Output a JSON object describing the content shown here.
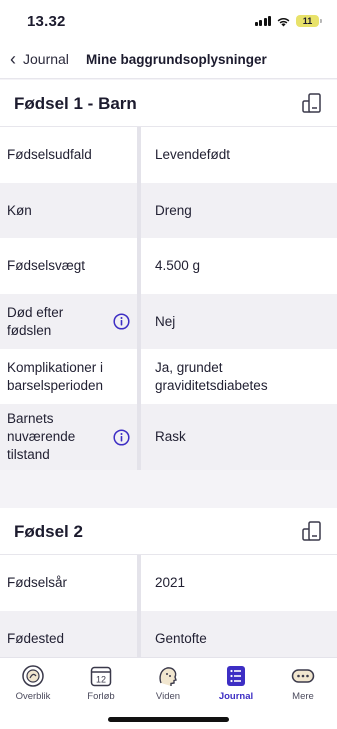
{
  "status": {
    "time": "13.32",
    "battery": "11"
  },
  "nav": {
    "back_label": "Journal",
    "title": "Mine baggrundsoplysninger"
  },
  "birth1": {
    "title": "Fødsel 1 - Barn",
    "rows": [
      {
        "label": "Fødselsudfald",
        "value": "Levendefødt"
      },
      {
        "label": "Køn",
        "value": "Dreng"
      },
      {
        "label": "Fødselsvægt",
        "value": "4.500 g"
      },
      {
        "label": "Død efter fødslen",
        "value": "Nej"
      },
      {
        "label": "Komplikationer i barselsperioden",
        "value": "Ja, grundet graviditetsdiabetes"
      },
      {
        "label": "Barnets nuværende tilstand",
        "value": "Rask"
      }
    ]
  },
  "birth2": {
    "title": "Fødsel 2",
    "rows": [
      {
        "label": "Fødselsår",
        "value": "2021"
      },
      {
        "label": "Fødested",
        "value": "Gentofte"
      }
    ]
  },
  "tabs": [
    {
      "label": "Overblik",
      "icon": "overview-icon"
    },
    {
      "label": "Forløb",
      "icon": "calendar-icon",
      "badge": "12"
    },
    {
      "label": "Viden",
      "icon": "knowledge-icon"
    },
    {
      "label": "Journal",
      "icon": "journal-icon",
      "active": true
    },
    {
      "label": "Mere",
      "icon": "more-icon"
    }
  ],
  "colors": {
    "accent": "#3d2ec4",
    "text": "#1c1b2e",
    "row_alt": "#f1f0f4",
    "background": "#f4f3f7"
  }
}
